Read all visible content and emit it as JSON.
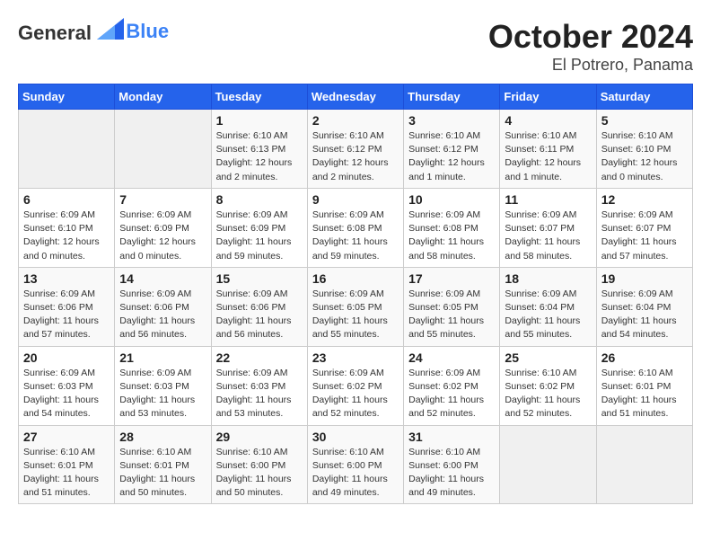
{
  "header": {
    "logo_general": "General",
    "logo_blue": "Blue",
    "month": "October 2024",
    "location": "El Potrero, Panama"
  },
  "days_of_week": [
    "Sunday",
    "Monday",
    "Tuesday",
    "Wednesday",
    "Thursday",
    "Friday",
    "Saturday"
  ],
  "weeks": [
    [
      {
        "day": "",
        "empty": true
      },
      {
        "day": "",
        "empty": true
      },
      {
        "day": "1",
        "sunrise": "Sunrise: 6:10 AM",
        "sunset": "Sunset: 6:13 PM",
        "daylight": "Daylight: 12 hours and 2 minutes."
      },
      {
        "day": "2",
        "sunrise": "Sunrise: 6:10 AM",
        "sunset": "Sunset: 6:12 PM",
        "daylight": "Daylight: 12 hours and 2 minutes."
      },
      {
        "day": "3",
        "sunrise": "Sunrise: 6:10 AM",
        "sunset": "Sunset: 6:12 PM",
        "daylight": "Daylight: 12 hours and 1 minute."
      },
      {
        "day": "4",
        "sunrise": "Sunrise: 6:10 AM",
        "sunset": "Sunset: 6:11 PM",
        "daylight": "Daylight: 12 hours and 1 minute."
      },
      {
        "day": "5",
        "sunrise": "Sunrise: 6:10 AM",
        "sunset": "Sunset: 6:10 PM",
        "daylight": "Daylight: 12 hours and 0 minutes."
      }
    ],
    [
      {
        "day": "6",
        "sunrise": "Sunrise: 6:09 AM",
        "sunset": "Sunset: 6:10 PM",
        "daylight": "Daylight: 12 hours and 0 minutes."
      },
      {
        "day": "7",
        "sunrise": "Sunrise: 6:09 AM",
        "sunset": "Sunset: 6:09 PM",
        "daylight": "Daylight: 12 hours and 0 minutes."
      },
      {
        "day": "8",
        "sunrise": "Sunrise: 6:09 AM",
        "sunset": "Sunset: 6:09 PM",
        "daylight": "Daylight: 11 hours and 59 minutes."
      },
      {
        "day": "9",
        "sunrise": "Sunrise: 6:09 AM",
        "sunset": "Sunset: 6:08 PM",
        "daylight": "Daylight: 11 hours and 59 minutes."
      },
      {
        "day": "10",
        "sunrise": "Sunrise: 6:09 AM",
        "sunset": "Sunset: 6:08 PM",
        "daylight": "Daylight: 11 hours and 58 minutes."
      },
      {
        "day": "11",
        "sunrise": "Sunrise: 6:09 AM",
        "sunset": "Sunset: 6:07 PM",
        "daylight": "Daylight: 11 hours and 58 minutes."
      },
      {
        "day": "12",
        "sunrise": "Sunrise: 6:09 AM",
        "sunset": "Sunset: 6:07 PM",
        "daylight": "Daylight: 11 hours and 57 minutes."
      }
    ],
    [
      {
        "day": "13",
        "sunrise": "Sunrise: 6:09 AM",
        "sunset": "Sunset: 6:06 PM",
        "daylight": "Daylight: 11 hours and 57 minutes."
      },
      {
        "day": "14",
        "sunrise": "Sunrise: 6:09 AM",
        "sunset": "Sunset: 6:06 PM",
        "daylight": "Daylight: 11 hours and 56 minutes."
      },
      {
        "day": "15",
        "sunrise": "Sunrise: 6:09 AM",
        "sunset": "Sunset: 6:06 PM",
        "daylight": "Daylight: 11 hours and 56 minutes."
      },
      {
        "day": "16",
        "sunrise": "Sunrise: 6:09 AM",
        "sunset": "Sunset: 6:05 PM",
        "daylight": "Daylight: 11 hours and 55 minutes."
      },
      {
        "day": "17",
        "sunrise": "Sunrise: 6:09 AM",
        "sunset": "Sunset: 6:05 PM",
        "daylight": "Daylight: 11 hours and 55 minutes."
      },
      {
        "day": "18",
        "sunrise": "Sunrise: 6:09 AM",
        "sunset": "Sunset: 6:04 PM",
        "daylight": "Daylight: 11 hours and 55 minutes."
      },
      {
        "day": "19",
        "sunrise": "Sunrise: 6:09 AM",
        "sunset": "Sunset: 6:04 PM",
        "daylight": "Daylight: 11 hours and 54 minutes."
      }
    ],
    [
      {
        "day": "20",
        "sunrise": "Sunrise: 6:09 AM",
        "sunset": "Sunset: 6:03 PM",
        "daylight": "Daylight: 11 hours and 54 minutes."
      },
      {
        "day": "21",
        "sunrise": "Sunrise: 6:09 AM",
        "sunset": "Sunset: 6:03 PM",
        "daylight": "Daylight: 11 hours and 53 minutes."
      },
      {
        "day": "22",
        "sunrise": "Sunrise: 6:09 AM",
        "sunset": "Sunset: 6:03 PM",
        "daylight": "Daylight: 11 hours and 53 minutes."
      },
      {
        "day": "23",
        "sunrise": "Sunrise: 6:09 AM",
        "sunset": "Sunset: 6:02 PM",
        "daylight": "Daylight: 11 hours and 52 minutes."
      },
      {
        "day": "24",
        "sunrise": "Sunrise: 6:09 AM",
        "sunset": "Sunset: 6:02 PM",
        "daylight": "Daylight: 11 hours and 52 minutes."
      },
      {
        "day": "25",
        "sunrise": "Sunrise: 6:10 AM",
        "sunset": "Sunset: 6:02 PM",
        "daylight": "Daylight: 11 hours and 52 minutes."
      },
      {
        "day": "26",
        "sunrise": "Sunrise: 6:10 AM",
        "sunset": "Sunset: 6:01 PM",
        "daylight": "Daylight: 11 hours and 51 minutes."
      }
    ],
    [
      {
        "day": "27",
        "sunrise": "Sunrise: 6:10 AM",
        "sunset": "Sunset: 6:01 PM",
        "daylight": "Daylight: 11 hours and 51 minutes."
      },
      {
        "day": "28",
        "sunrise": "Sunrise: 6:10 AM",
        "sunset": "Sunset: 6:01 PM",
        "daylight": "Daylight: 11 hours and 50 minutes."
      },
      {
        "day": "29",
        "sunrise": "Sunrise: 6:10 AM",
        "sunset": "Sunset: 6:00 PM",
        "daylight": "Daylight: 11 hours and 50 minutes."
      },
      {
        "day": "30",
        "sunrise": "Sunrise: 6:10 AM",
        "sunset": "Sunset: 6:00 PM",
        "daylight": "Daylight: 11 hours and 49 minutes."
      },
      {
        "day": "31",
        "sunrise": "Sunrise: 6:10 AM",
        "sunset": "Sunset: 6:00 PM",
        "daylight": "Daylight: 11 hours and 49 minutes."
      },
      {
        "day": "",
        "empty": true
      },
      {
        "day": "",
        "empty": true
      }
    ]
  ]
}
